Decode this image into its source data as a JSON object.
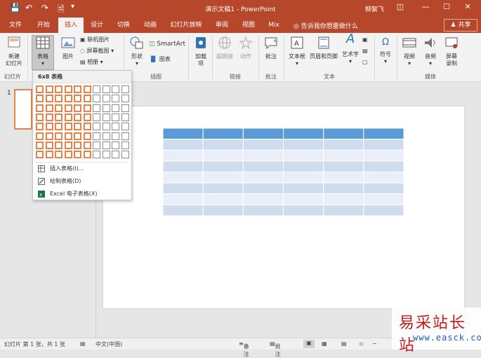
{
  "titlebar": {
    "title": "演示文稿1 - PowerPoint",
    "user": "柳絮飞"
  },
  "tabs": [
    "文件",
    "开始",
    "插入",
    "设计",
    "切换",
    "动画",
    "幻灯片放映",
    "审阅",
    "视图",
    "Mix"
  ],
  "active_tab": "插入",
  "tell_me": "告诉我你想要做什么",
  "share": "共享",
  "ribbon": {
    "new_slide": "新建\n幻灯片",
    "table": "表格",
    "picture": "图片",
    "online_pictures": "联机图片",
    "screenshot": "屏幕截图",
    "album": "相册",
    "shapes": "形状",
    "smartart": "SmartArt",
    "chart": "图表",
    "addins": "加载\n项",
    "hyperlink": "超链接",
    "action": "动作",
    "comment": "批注",
    "textbox": "文本框",
    "header_footer": "页眉和页脚",
    "wordart": "艺术字",
    "symbol": "符号",
    "video": "视频",
    "audio": "音频",
    "screen_record": "屏幕\n录制",
    "groups": {
      "slides": "幻灯片",
      "illustrations": "插图",
      "links": "链接",
      "comments": "批注",
      "text": "文本",
      "media": "媒体"
    }
  },
  "dropdown": {
    "header": "6x8 表格",
    "grid_cols": 10,
    "grid_rows": 8,
    "selected_cols": 6,
    "selected_rows": 8,
    "items": [
      {
        "label": "插入表格(I)...",
        "icon": "table-grid-icon"
      },
      {
        "label": "绘制表格(D)",
        "icon": "pencil-icon"
      },
      {
        "label": "Excel 电子表格(X)",
        "icon": "excel-icon"
      }
    ]
  },
  "slide_panel": {
    "number": "1"
  },
  "preview_table": {
    "cols": 6,
    "rows": 8,
    "header_color": "#5b9bd5",
    "band_dark": "#cfdcee",
    "band_light": "#e9eff8"
  },
  "status": {
    "slide": "幻灯片 第 1 张，共 1 张",
    "language": "中文(中国)",
    "notes": "备注",
    "comments": "批注"
  },
  "watermark": {
    "line1": "易采站长站",
    "line2": "www.easck.com"
  },
  "colors": {
    "accent": "#b7472a",
    "selection": "#e8824b"
  }
}
